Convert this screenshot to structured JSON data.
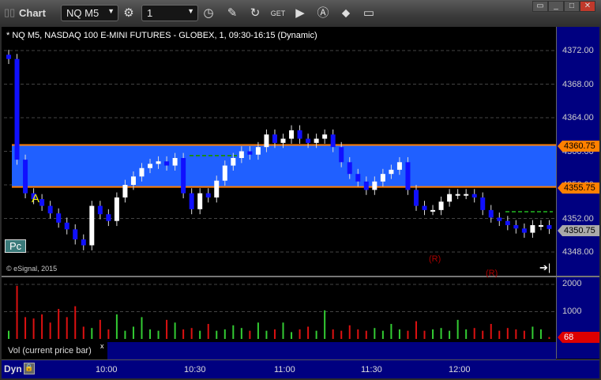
{
  "titlebar": {
    "title": "Chart",
    "symbol": "NQ M5",
    "interval": "1"
  },
  "icons": [
    "gear-icon",
    "clock-icon",
    "pencil-icon",
    "refresh-icon",
    "get-icon",
    "play-icon",
    "alert-icon",
    "link-icon",
    "comment-icon"
  ],
  "chart": {
    "header": "* NQ M5, NASDAQ 100 E-MINI FUTURES - GLOBEX, 1, 09:30-16:15 (Dynamic)",
    "copyright": "© eSignal, 2015",
    "pc_label": "Pc",
    "marker_a": "A",
    "r_labels": [
      "(R)",
      "(R)"
    ],
    "price_ticks": [
      "4372.00",
      "4368.00",
      "4364.00",
      "4360.00",
      "4356.00",
      "4352.00",
      "4348.00"
    ],
    "upper_level": "4360.75",
    "lower_level": "4355.75",
    "last_price": "4350.75",
    "colors": {
      "band": "#2060ff",
      "level": "#ff8000",
      "up": "#ffffff",
      "down": "#1010ff"
    }
  },
  "volume": {
    "label": "Vol (current price bar)",
    "close": "x",
    "ticks": [
      "2000",
      "1000"
    ],
    "last": "68"
  },
  "timeaxis": {
    "mode": "Dyn",
    "ticks": [
      "10:00",
      "10:30",
      "11:00",
      "11:30",
      "12:00"
    ]
  },
  "chart_data": {
    "type": "candlestick",
    "ylim": [
      4346,
      4376
    ],
    "closes": [
      4371,
      4359,
      4355,
      4354.3,
      4353.5,
      4352.6,
      4351.5,
      4350.7,
      4349.5,
      4348.8,
      4353.5,
      4352.5,
      4351.7,
      4354.5,
      4356,
      4357,
      4358,
      4358.5,
      4358.8,
      4358.3,
      4359.2,
      4355,
      4353.1,
      4355,
      4354.5,
      4356.5,
      4358.3,
      4359.2,
      4360,
      4359.6,
      4360.5,
      4362,
      4361,
      4361.5,
      4362.5,
      4361.5,
      4361,
      4361.5,
      4362,
      4360.5,
      4358.7,
      4357.3,
      4356.4,
      4355.4,
      4356.4,
      4357.3,
      4357.8,
      4358.7,
      4355.4,
      4353.5,
      4353,
      4353,
      4354,
      4354.9,
      4354.9,
      4354.9,
      4354.5,
      4353,
      4352.1,
      4351.7,
      4351.2,
      4350.8,
      4350.3,
      4351.2,
      4351.2,
      4350.75
    ],
    "volumes": [
      300,
      1950,
      800,
      750,
      900,
      600,
      1100,
      800,
      1200,
      450,
      400,
      700,
      350,
      900,
      300,
      450,
      800,
      350,
      300,
      700,
      600,
      350,
      400,
      300,
      550,
      300,
      350,
      500,
      400,
      300,
      600,
      300,
      350,
      600,
      250,
      350,
      450,
      300,
      1050,
      350,
      300,
      500,
      350,
      300,
      400,
      300,
      550,
      350,
      300,
      650,
      300,
      350,
      400,
      300,
      700,
      350,
      400,
      300,
      550,
      300,
      400,
      350,
      300,
      450,
      350,
      68
    ],
    "volume_ylim": [
      0,
      2000
    ]
  }
}
